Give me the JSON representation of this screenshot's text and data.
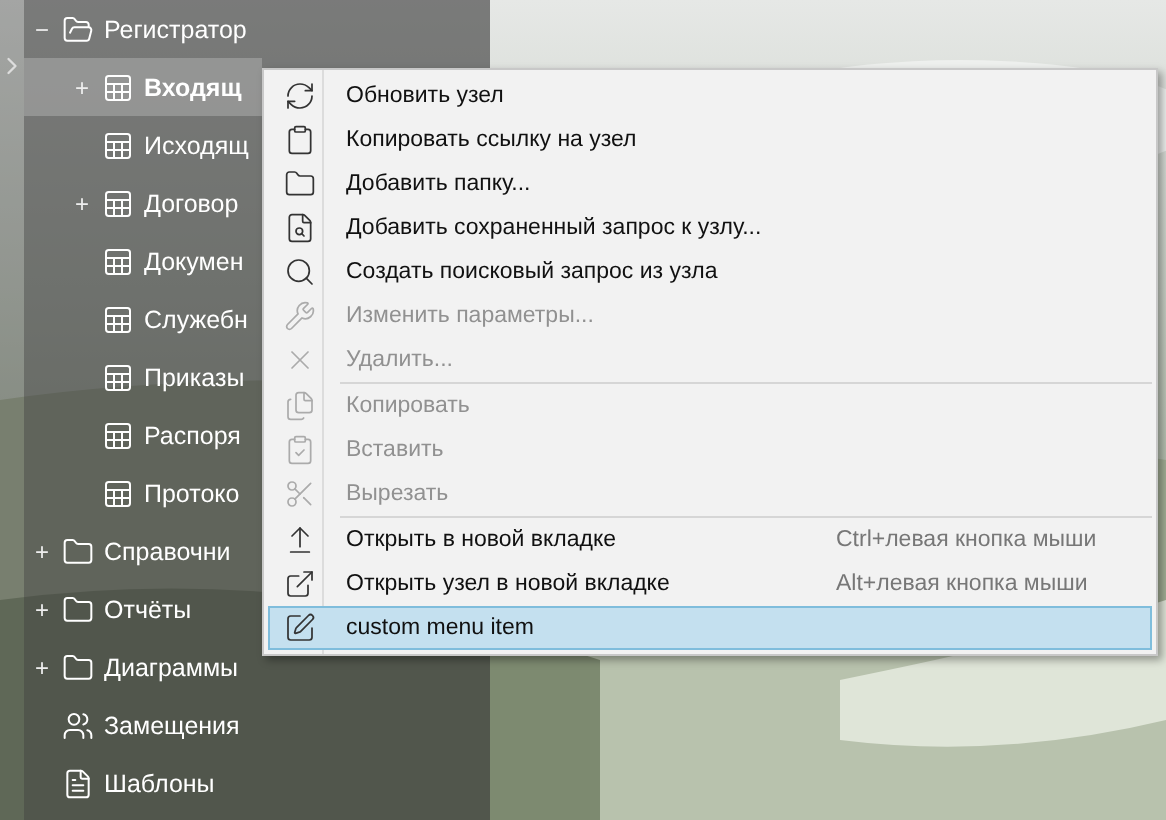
{
  "sidebar": {
    "tree": [
      {
        "label": "Регистратор",
        "kind": "folder-open",
        "toggle": "−",
        "selected": false,
        "children": [
          {
            "label": "Входящ",
            "kind": "table",
            "toggle": "+",
            "selected": true
          },
          {
            "label": "Исходящ",
            "kind": "table",
            "selected": false
          },
          {
            "label": "Договор",
            "kind": "table",
            "toggle": "+",
            "selected": false
          },
          {
            "label": "Докумен",
            "kind": "table",
            "selected": false
          },
          {
            "label": "Служебн",
            "kind": "table",
            "selected": false
          },
          {
            "label": "Приказы",
            "kind": "table",
            "selected": false
          },
          {
            "label": "Распоря",
            "kind": "table",
            "selected": false
          },
          {
            "label": "Протоко",
            "kind": "table",
            "selected": false
          }
        ]
      },
      {
        "label": "Справочни",
        "kind": "folder",
        "toggle": "+",
        "selected": false
      },
      {
        "label": "Отчёты",
        "kind": "folder",
        "toggle": "+",
        "selected": false
      },
      {
        "label": "Диаграммы",
        "kind": "folder",
        "toggle": "+",
        "selected": false
      },
      {
        "label": "Замещения",
        "kind": "people",
        "selected": false
      },
      {
        "label": "Шаблоны",
        "kind": "template",
        "selected": false
      }
    ]
  },
  "context_menu": {
    "items": [
      {
        "kind": "item",
        "label": "Обновить узел",
        "disabled": false,
        "selected": false
      },
      {
        "kind": "item",
        "label": "Копировать ссылку на узел",
        "disabled": false,
        "selected": false
      },
      {
        "kind": "item",
        "label": "Добавить папку...",
        "disabled": false,
        "selected": false
      },
      {
        "kind": "item",
        "label": "Добавить сохраненный запрос к узлу...",
        "disabled": false,
        "selected": false
      },
      {
        "kind": "item",
        "label": "Создать поисковый запрос из узла",
        "disabled": false,
        "selected": false
      },
      {
        "kind": "item",
        "label": "Изменить параметры...",
        "disabled": true,
        "selected": false
      },
      {
        "kind": "item",
        "label": "Удалить...",
        "disabled": true,
        "selected": false
      },
      {
        "kind": "separator"
      },
      {
        "kind": "item",
        "label": "Копировать",
        "disabled": true,
        "selected": false
      },
      {
        "kind": "item",
        "label": "Вставить",
        "disabled": true,
        "selected": false
      },
      {
        "kind": "item",
        "label": "Вырезать",
        "disabled": true,
        "selected": false
      },
      {
        "kind": "separator"
      },
      {
        "kind": "item",
        "label": "Открыть в новой вкладке",
        "shortcut": "Ctrl+левая кнопка мыши",
        "disabled": false,
        "selected": false
      },
      {
        "kind": "item",
        "label": "Открыть узел в новой вкладке",
        "shortcut": "Alt+левая кнопка мыши",
        "disabled": false,
        "selected": false
      },
      {
        "kind": "item",
        "label": "custom menu item",
        "disabled": false,
        "selected": true
      }
    ]
  }
}
